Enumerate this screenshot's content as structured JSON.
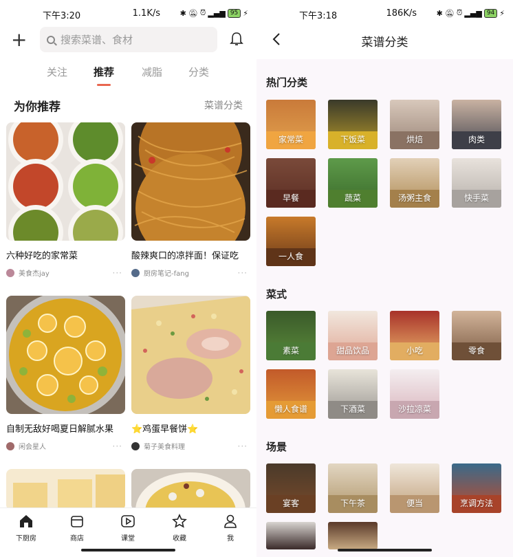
{
  "left": {
    "status": {
      "time": "下午3:20",
      "net": "1.1K/s",
      "battery": "95"
    },
    "search_placeholder": "搜索菜谱、食材",
    "tabs": [
      "关注",
      "推荐",
      "减脂",
      "分类"
    ],
    "section_title": "为你推荐",
    "section_link": "菜谱分类",
    "cards": [
      {
        "title": "六种好吃的家常菜",
        "author": "美食杰jay"
      },
      {
        "title": "酸辣爽口的凉拌面！保证吃",
        "author": "厨房笔记-fang"
      },
      {
        "title": "自制无敌好喝夏日解腻水果",
        "author": "闲会星人"
      },
      {
        "title": "⭐鸡蛋早餐饼⭐",
        "author": "菊子美食料理"
      }
    ],
    "more": "···",
    "nav": [
      "下厨房",
      "商店",
      "课堂",
      "收藏",
      "我"
    ]
  },
  "right": {
    "status": {
      "time": "下午3:18",
      "net": "186K/s",
      "battery": "94"
    },
    "title": "菜谱分类",
    "groups": [
      {
        "name": "热门分类",
        "items": [
          "家常菜",
          "下饭菜",
          "烘焙",
          "肉类",
          "早餐",
          "蔬菜",
          "汤粥主食",
          "快手菜",
          "一人食"
        ]
      },
      {
        "name": "菜式",
        "items": [
          "素菜",
          "甜品饮品",
          "小吃",
          "零食",
          "懒人食谱",
          "下酒菜",
          "沙拉凉菜"
        ]
      },
      {
        "name": "场景",
        "items": [
          "宴客",
          "下午茶",
          "便当",
          "烹调方法"
        ]
      }
    ]
  },
  "colors": {
    "accent": "#e8664f"
  }
}
